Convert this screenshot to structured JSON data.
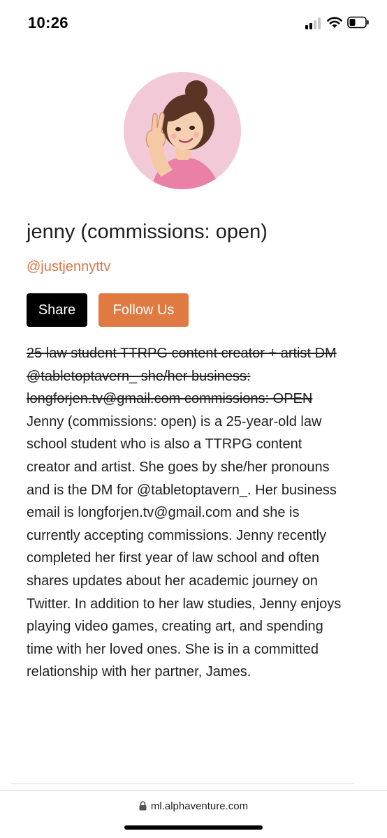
{
  "status_bar": {
    "time": "10:26"
  },
  "profile": {
    "avatar_icon": "avatar-illustration",
    "display_name": "jenny (commissions: open)",
    "handle": "@justjennyttv"
  },
  "actions": {
    "share_label": "Share",
    "follow_label": "Follow Us"
  },
  "bio": {
    "struck_text": "25 law student TTRPG content creator + artist DM @tabletoptavern_ she/her business: longforjen.tv@gmail.com commissions: OPEN",
    "text": "Jenny (commissions: open) is a 25-year-old law school student who is also a TTRPG content creator and artist. She goes by she/her pronouns and is the DM for @tabletoptavern_. Her business email is longforjen.tv@gmail.com and she is currently accepting commissions. Jenny recently completed her first year of law school and often shares updates about her academic journey on Twitter. In addition to her law studies, Jenny enjoys playing video games, creating art, and spending time with her loved ones. She is in a committed relationship with her partner, James."
  },
  "browser": {
    "url": "ml.alphaventure.com"
  },
  "colors": {
    "accent": "#e07a43",
    "handle": "#d97745",
    "share_bg": "#000000",
    "avatar_bg": "#f2c9d6"
  }
}
